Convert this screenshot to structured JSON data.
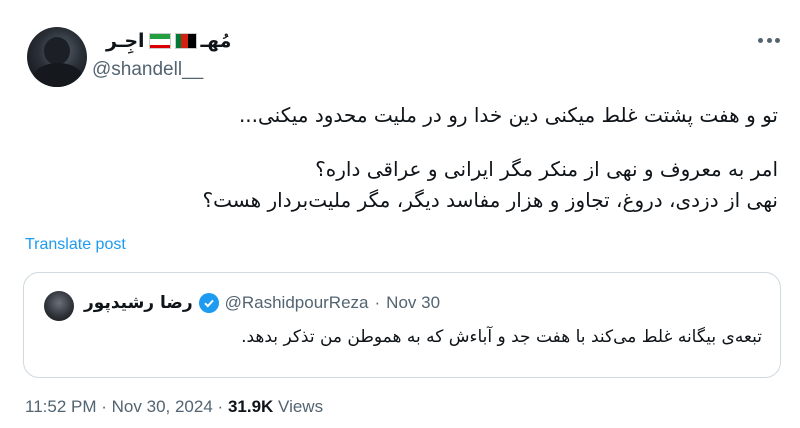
{
  "author": {
    "display_name": "مُهـ",
    "display_name_suffix": "اجِـر",
    "handle": "@shandell__",
    "flag_af_icon": "afghanistan-flag-icon",
    "flag_ir_icon": "iran-flag-icon"
  },
  "post": {
    "lines": [
      "تو و هفت پشتت غلط میکنی دین خدا رو در ملیت محدود میکنی...",
      "امر به معروف و نهی از منکر مگر ایرانی و عراقی داره؟",
      "نهی از دزدی، دروغ، تجاوز و هزار مفاسد دیگر، مگر ملیت‌بردار هست؟"
    ],
    "translate_label": "Translate post"
  },
  "quoted": {
    "display_name": "رضا رشیدپور",
    "handle": "@RashidpourReza",
    "separator": "·",
    "date": "Nov 30",
    "text": "تبعه‌ی بیگانه غلط می‌کند با هفت جد و آباءش که به هموطن من تذکر بدهد."
  },
  "meta": {
    "time": "11:52 PM",
    "separator1": "·",
    "date": "Nov 30, 2024",
    "separator2": "·",
    "views_count": "31.9K",
    "views_label": "Views"
  },
  "colors": {
    "link": "#1d9bf0",
    "secondary": "#536471",
    "text": "#0f1419"
  }
}
